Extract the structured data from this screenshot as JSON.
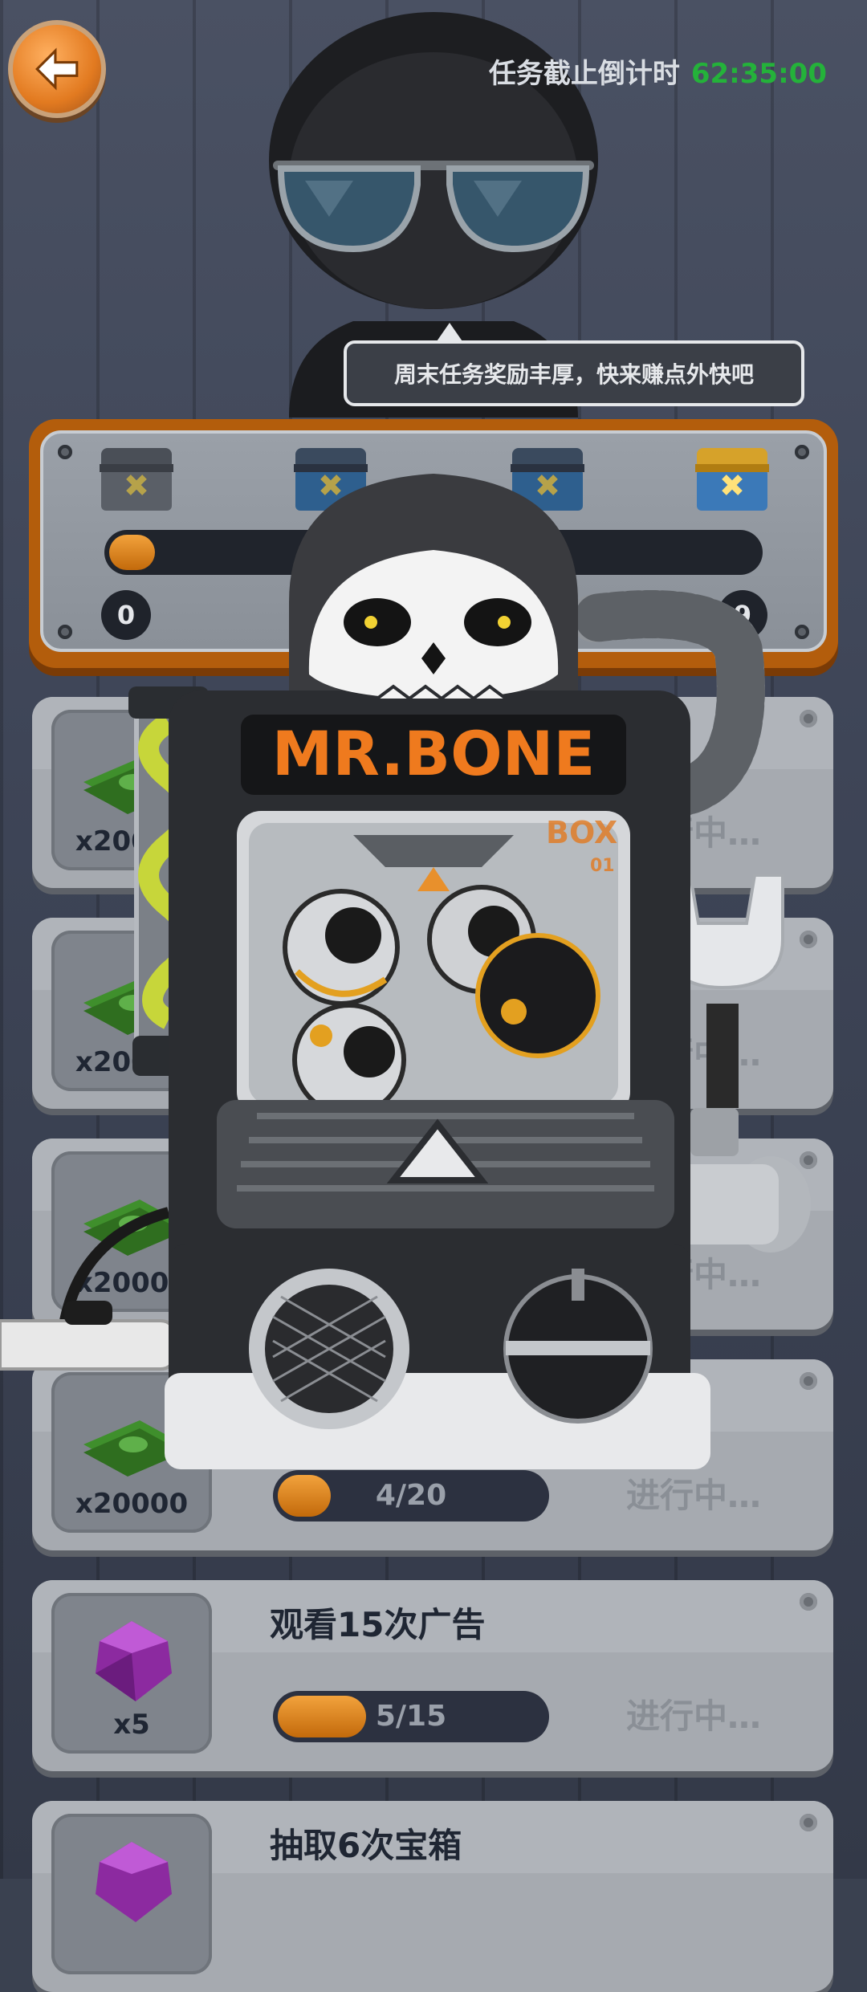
{
  "header": {
    "countdown_label": "任务截止倒计时",
    "countdown_value": "62:35:00"
  },
  "speech": "周末任务奖励丰厚，快来赚点外快吧",
  "chest_progress": {
    "start": "0",
    "end": "9",
    "fill_fraction": 0.07
  },
  "machine": {
    "title": "MR.BONE",
    "box_label": "BOX",
    "box_number": "01"
  },
  "tasks": [
    {
      "reward": "x20000",
      "title": "",
      "progress": "",
      "status": "进行中…",
      "fill": 0.0
    },
    {
      "reward": "x20000",
      "title": "",
      "progress": "",
      "status": "进行中…",
      "fill": 0.0
    },
    {
      "reward": "x20000",
      "title": "",
      "progress": "",
      "status": "进行中…",
      "fill": 0.0
    },
    {
      "reward": "x20000",
      "title": "",
      "progress": "4/20",
      "status": "进行中…",
      "fill": 0.2
    },
    {
      "reward": "x5",
      "title": "观看15次广告",
      "progress": "5/15",
      "status": "进行中…",
      "fill": 0.33
    },
    {
      "reward": "",
      "title": "抽取6次宝箱",
      "progress": "",
      "status": "",
      "fill": 0.0
    }
  ],
  "colors": {
    "accent_orange": "#e27a20",
    "timer_green": "#24b23a",
    "progress_orange": "#f2a23c"
  }
}
